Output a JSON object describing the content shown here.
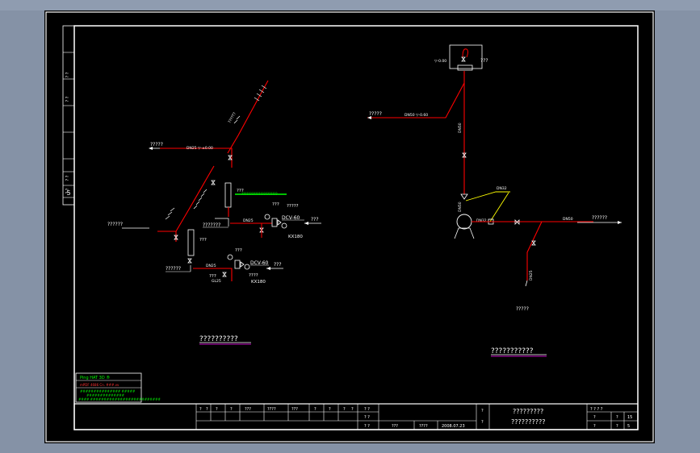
{
  "drawing": {
    "left_title": "??????????",
    "right_title": "???????????",
    "left": {
      "riser_label_top": "??????",
      "riser_label_mid": "??????",
      "supply_top_label": "?????",
      "supply_top_pipe": "DN25 ▽-±0.00",
      "branch_left_label": "??????",
      "tag_a": "???",
      "tag_b": "???",
      "green_note": "???",
      "green_note_text": "?????????????????????",
      "upper_line_label": "???????",
      "upper_pipe": "DN25",
      "upper_valve": "DCV-60",
      "upper_valve2": "?????",
      "upper_kx": "KX180",
      "upper_right_label": "???",
      "upper_tag1": "???",
      "lower_line_label": "??????",
      "lower_pipe": "DN25",
      "lower_tag1": "???",
      "lower_tag2": "???",
      "lower_tag3": "GL25",
      "lower_valve": "DCV-60",
      "lower_valve2": "????",
      "lower_kx": "KX180",
      "lower_right_label": "???"
    },
    "right": {
      "tank_label": "???",
      "tank_level": "▽-0.00",
      "supply_label": "?????",
      "supply_pipe": "DN50 ▽-0.60",
      "vertical_pipe": "DN50",
      "pump_pipe": "DN32",
      "pump_tag": "DN50",
      "pump_inlet": "DN32",
      "outlet_label": "??????",
      "outlet_pipe": "DN50",
      "drain_label": "?????",
      "drain_pipe": "DN25"
    }
  },
  "stamp": {
    "line1": "Ping HAT 3D ®",
    "line2": "mPDF 4686   Cn. ###.vv",
    "line3": "############### #####",
    "line4": "##############",
    "line5": "#### ##########################"
  },
  "title_block": {
    "row1": [
      "?",
      "?",
      "?",
      "?",
      "???",
      "????",
      "???",
      "?",
      "?",
      "?",
      "?",
      "?"
    ],
    "row2": [
      "?",
      "?",
      "?",
      "?",
      "?",
      "?",
      "?",
      "?",
      "?",
      "?",
      "?",
      "?"
    ],
    "rev_col": [
      "? ?",
      "? ?",
      "? ?"
    ],
    "designer": "???",
    "check": "????",
    "date": "2008.07.23",
    "sheet_mark": "?",
    "project_line1": "?????????",
    "project_line2": "??????????",
    "right_head": [
      "? ? ? ?",
      "? ?",
      "?"
    ],
    "right_row2": [
      "?",
      "?",
      "?",
      "15"
    ],
    "right_row3": [
      "?",
      "?",
      "?",
      "5"
    ]
  },
  "margin_strip": [
    "? ?",
    "? ?",
    "? ?",
    "? ?",
    "? ?",
    "? ?",
    "5"
  ],
  "colors": {
    "pipe": "#ff0000",
    "outline": "#ffffff",
    "note": "#00ff00",
    "title_underline_left": "#ff00ff",
    "title_underline_right": "#ff00ff",
    "leader": "#ffff00"
  }
}
